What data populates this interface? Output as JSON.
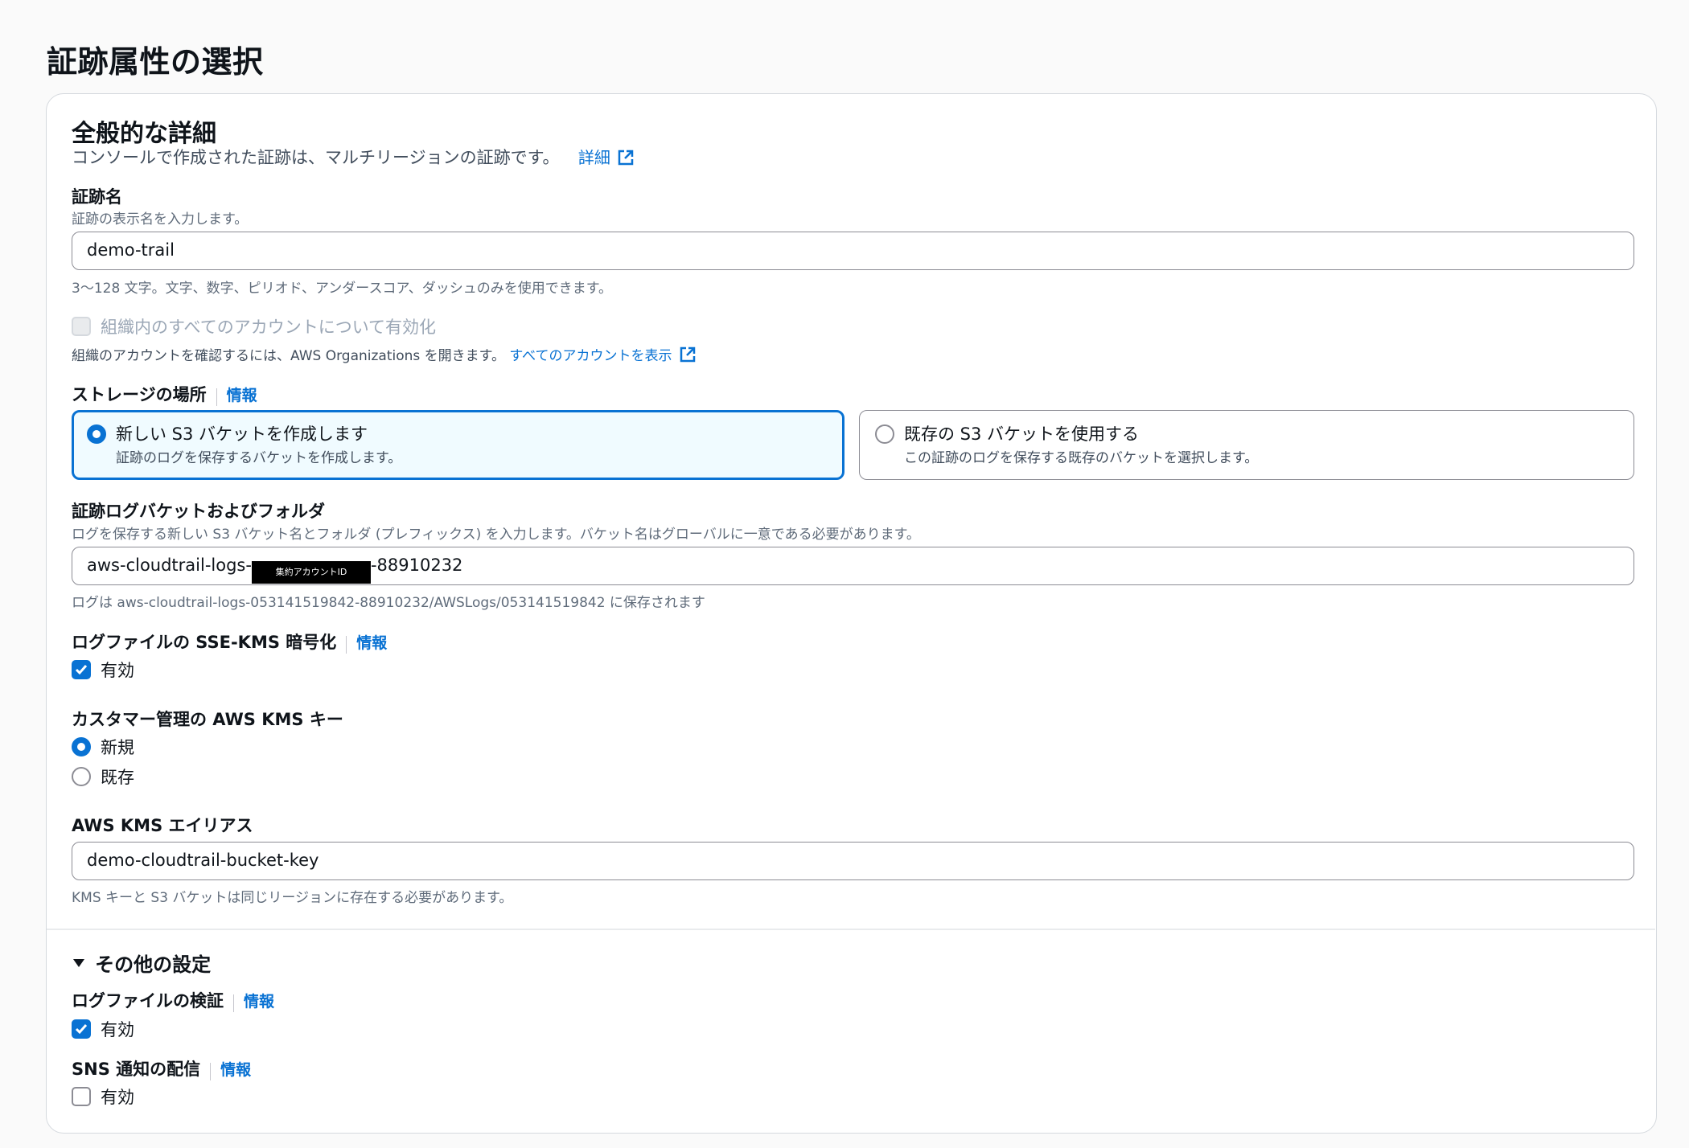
{
  "page": {
    "title": "証跡属性の選択"
  },
  "general": {
    "title": "全般的な詳細",
    "description": "コンソールで作成された証跡は、マルチリージョンの証跡です。",
    "details_link": "詳細",
    "trail_name": {
      "label": "証跡名",
      "description": "証跡の表示名を入力します。",
      "value": "demo-trail",
      "constraint": "3〜128 文字。文字、数字、ピリオド、アンダースコア、ダッシュのみを使用できます。"
    },
    "org": {
      "label": "組織内のすべてのアカウントについて有効化",
      "checked": false,
      "disabled": true,
      "description": "組織のアカウントを確認するには、AWS Organizations を開きます。",
      "link": "すべてのアカウントを表示"
    },
    "storage": {
      "label": "ストレージの場所",
      "info": "情報",
      "options": [
        {
          "title": "新しい S3 バケットを作成します",
          "description": "証跡のログを保存するバケットを作成します。",
          "selected": true
        },
        {
          "title": "既存の S3 バケットを使用する",
          "description": "この証跡のログを保存する既存のバケットを選択します。",
          "selected": false
        }
      ]
    },
    "bucket": {
      "label": "証跡ログバケットおよびフォルダ",
      "description": "ログを保存する新しい S3 バケット名とフォルダ (プレフィックス) を入力します。バケット名はグローバルに一意である必要があります。",
      "value_prefix": "aws-cloudtrail-logs-",
      "redacted_label": "集約アカウントID",
      "value_suffix": "-88910232",
      "hint": "ログは aws-cloudtrail-logs-053141519842-88910232/AWSLogs/053141519842 に保存されます"
    },
    "sse_kms": {
      "label": "ログファイルの SSE-KMS 暗号化",
      "info": "情報",
      "checkbox_label": "有効",
      "checked": true
    },
    "kms_key": {
      "label": "カスタマー管理の AWS KMS キー",
      "options": [
        {
          "label": "新規",
          "selected": true
        },
        {
          "label": "既存",
          "selected": false
        }
      ]
    },
    "kms_alias": {
      "label": "AWS KMS エイリアス",
      "value": "demo-cloudtrail-bucket-key",
      "hint": "KMS キーと S3 バケットは同じリージョンに存在する必要があります。"
    }
  },
  "other": {
    "title": "その他の設定",
    "expanded": true,
    "validation": {
      "label": "ログファイルの検証",
      "info": "情報",
      "checkbox_label": "有効",
      "checked": true
    },
    "sns": {
      "label": "SNS 通知の配信",
      "info": "情報",
      "checkbox_label": "有効",
      "checked": false
    }
  },
  "colors": {
    "accent": "#0972d3",
    "selected_bg": "#f0fbff",
    "border": "#8c8c94"
  }
}
